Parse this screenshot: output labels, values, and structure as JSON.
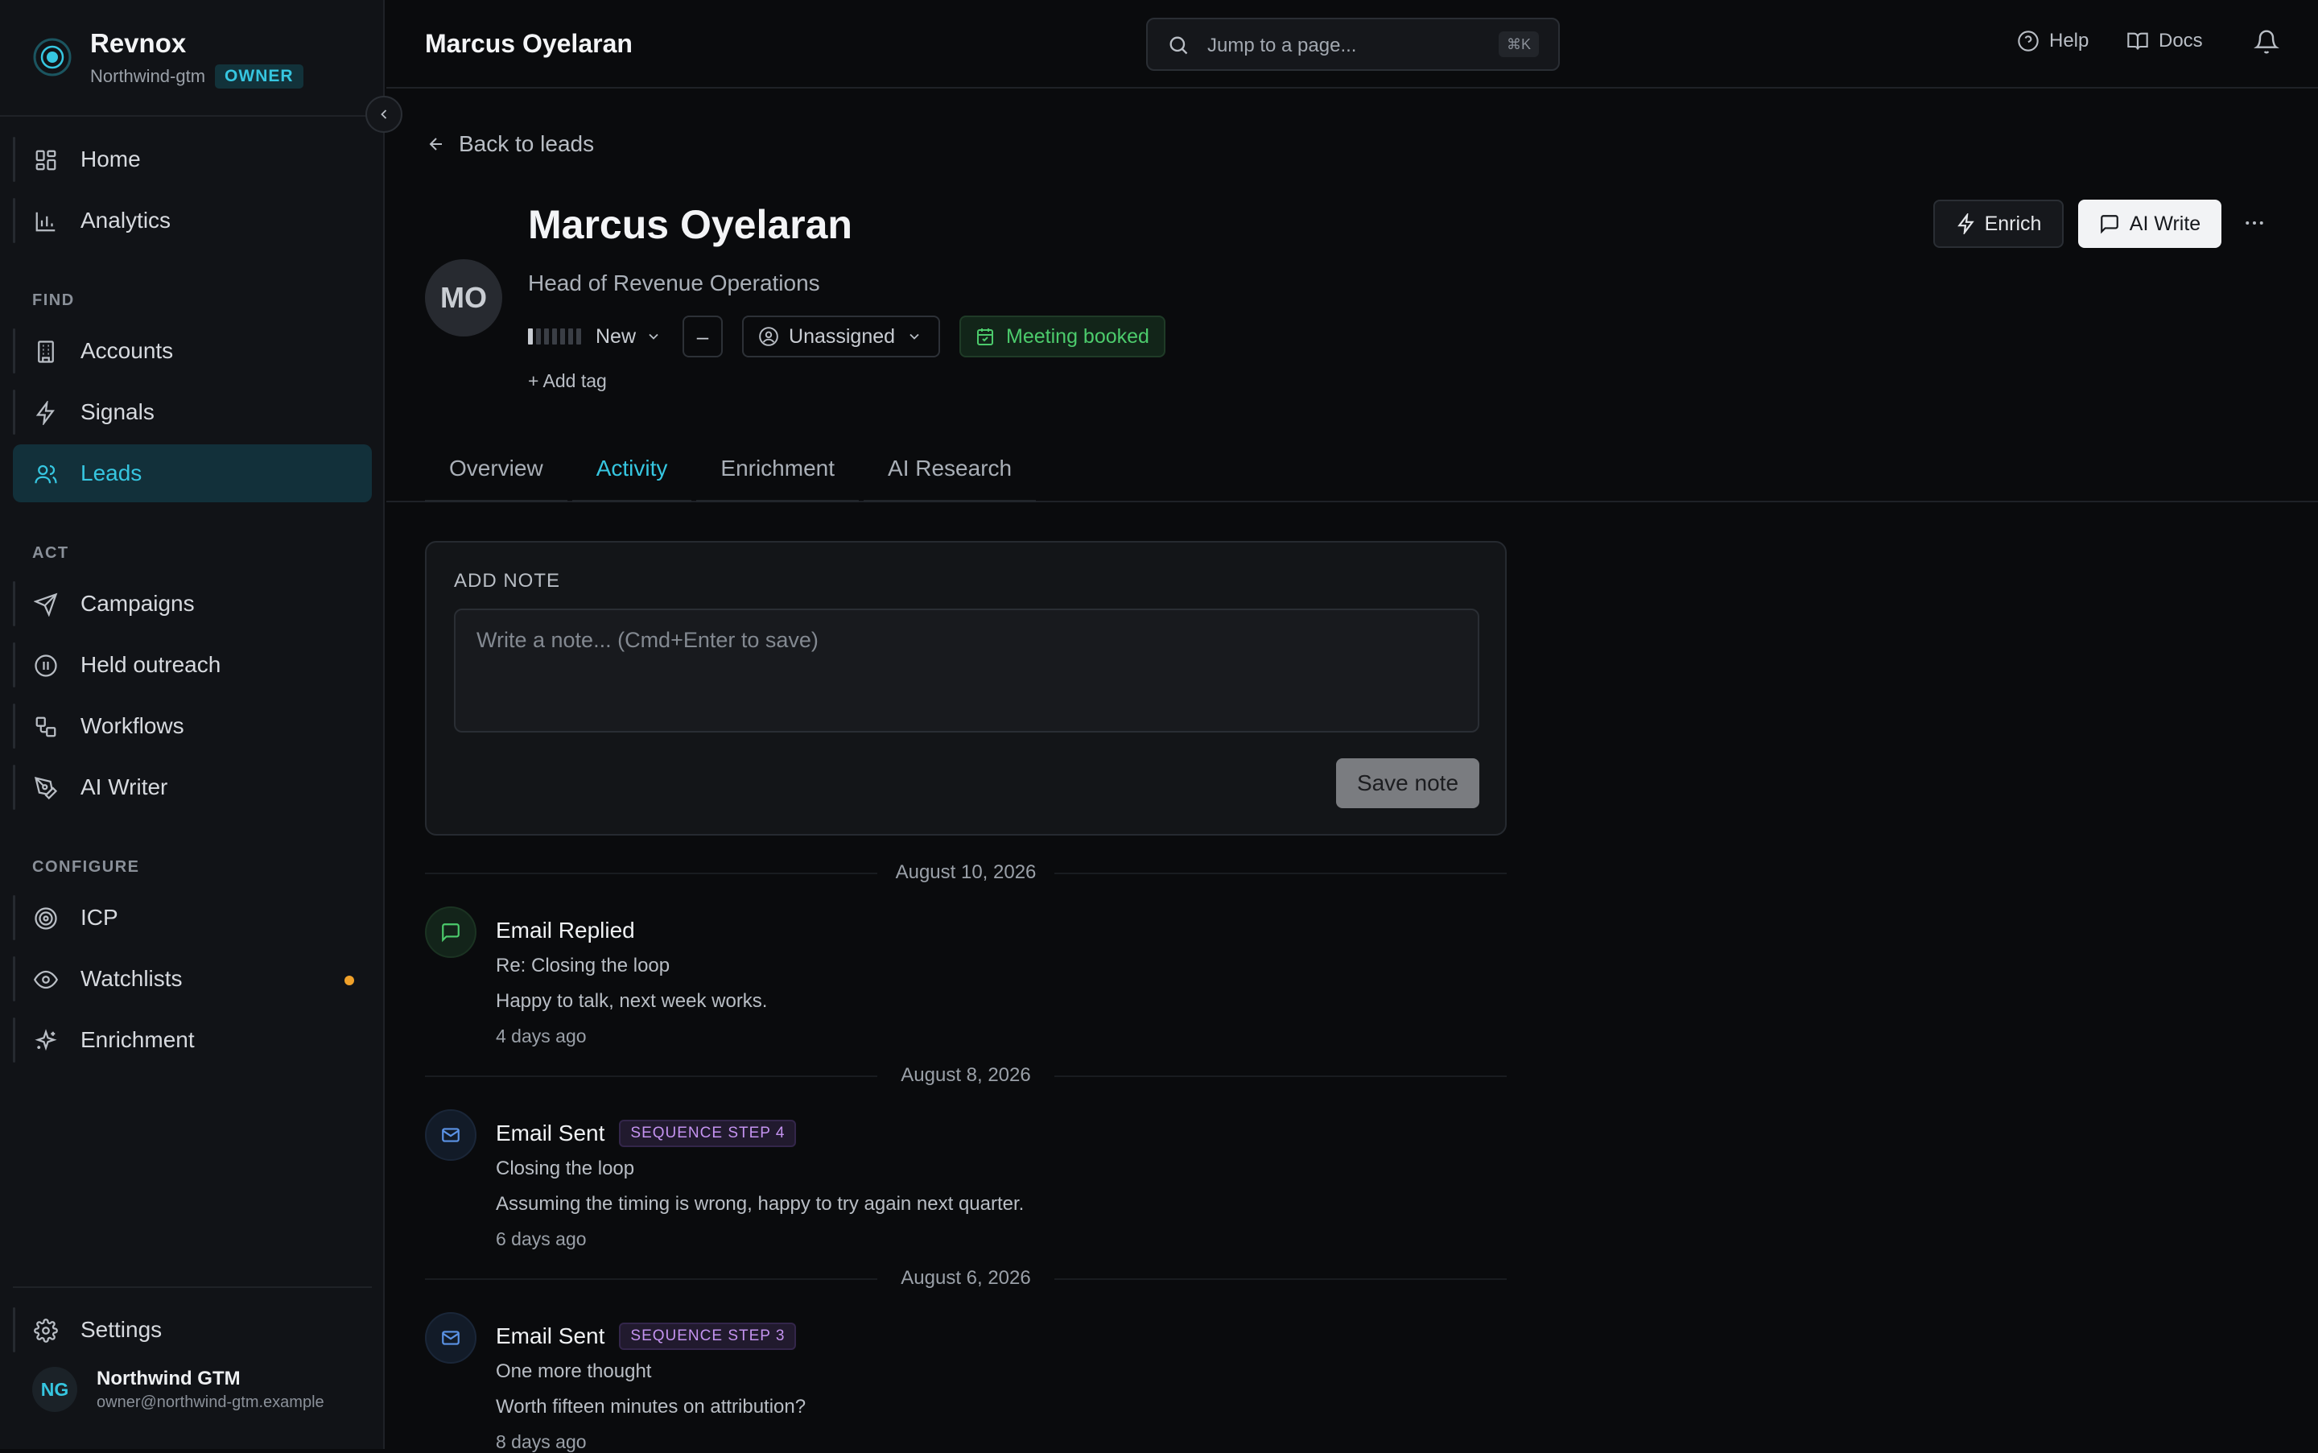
{
  "app": {
    "name": "Revnox",
    "org": "Northwind-gtm",
    "role": "OWNER"
  },
  "sidebar": {
    "nav_top": [
      {
        "label": "Home",
        "icon": "grid-icon"
      },
      {
        "label": "Analytics",
        "icon": "bar-chart-icon"
      }
    ],
    "sections": [
      {
        "label": "FIND",
        "items": [
          {
            "label": "Accounts",
            "icon": "building-icon"
          },
          {
            "label": "Signals",
            "icon": "lightning-icon"
          },
          {
            "label": "Leads",
            "icon": "users-icon",
            "active": true
          }
        ]
      },
      {
        "label": "ACT",
        "items": [
          {
            "label": "Campaigns",
            "icon": "send-icon"
          },
          {
            "label": "Held outreach",
            "icon": "pause-icon"
          },
          {
            "label": "Workflows",
            "icon": "workflow-icon"
          },
          {
            "label": "AI Writer",
            "icon": "pen-icon"
          }
        ]
      },
      {
        "label": "CONFIGURE",
        "items": [
          {
            "label": "ICP",
            "icon": "target-icon"
          },
          {
            "label": "Watchlists",
            "icon": "eye-icon",
            "dot": true
          },
          {
            "label": "Enrichment",
            "icon": "sparkle-icon"
          }
        ]
      }
    ],
    "settings_label": "Settings",
    "user": {
      "initials": "NG",
      "name": "Northwind GTM",
      "email": "owner@northwind-gtm.example"
    }
  },
  "topbar": {
    "title": "Marcus Oyelaran",
    "search_placeholder": "Jump to a page...",
    "search_shortcut": "⌘K",
    "help_label": "Help",
    "docs_label": "Docs"
  },
  "lead": {
    "back_label": "Back to leads",
    "initials": "MO",
    "name": "Marcus Oyelaran",
    "title": "Head of Revenue Operations",
    "score_level": 1,
    "score_max": 7,
    "status": "New",
    "dash": "–",
    "owner": "Unassigned",
    "meeting": "Meeting booked",
    "add_tag": "+ Add tag",
    "enrich_label": "Enrich",
    "ai_write_label": "AI Write"
  },
  "tabs": [
    "Overview",
    "Activity",
    "Enrichment",
    "AI Research"
  ],
  "active_tab": "Activity",
  "note": {
    "label": "ADD NOTE",
    "placeholder": "Write a note... (Cmd+Enter to save)",
    "save_label": "Save note"
  },
  "activity": [
    {
      "date": "August 10, 2026",
      "type": "Email Replied",
      "kind": "reply",
      "badge": "",
      "subject": "Re: Closing the loop",
      "body": "Happy to talk, next week works.",
      "time": "4 days ago"
    },
    {
      "date": "August 8, 2026",
      "type": "Email Sent",
      "kind": "sent",
      "badge": "SEQUENCE STEP 4",
      "subject": "Closing the loop",
      "body": "Assuming the timing is wrong, happy to try again next quarter.",
      "time": "6 days ago"
    },
    {
      "date": "August 6, 2026",
      "type": "Email Sent",
      "kind": "sent",
      "badge": "SEQUENCE STEP 3",
      "subject": "One more thought",
      "body": "Worth fifteen minutes on attribution?",
      "time": "8 days ago"
    }
  ],
  "colors": {
    "accent": "#36c6e0",
    "success": "#4ccb6c",
    "badge_purple": "#c493f0",
    "warning_dot": "#f0a12a"
  }
}
